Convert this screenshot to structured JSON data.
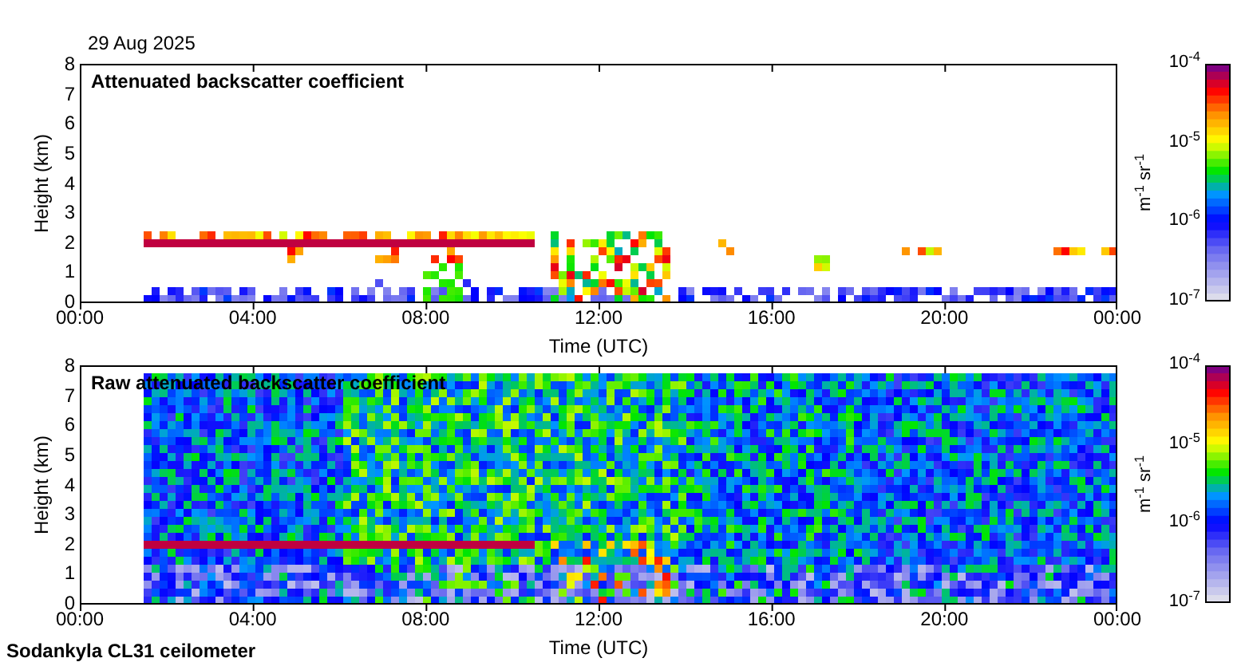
{
  "date": "29 Aug 2025",
  "panels": [
    {
      "kind": "filtered",
      "title": "Attenuated backscatter coefficient",
      "ylabel": "Height (km)",
      "yticks": [
        "8",
        "7",
        "6",
        "5",
        "4",
        "3",
        "2",
        "1",
        "0"
      ],
      "xticks": [
        "00:00",
        "04:00",
        "08:00",
        "12:00",
        "16:00",
        "20:00",
        "00:00"
      ],
      "xlabel": "Time (UTC)",
      "colorbar": {
        "unit": "m$^{-1}$ sr$^{-1}$",
        "ticks": [
          "10$^{-4}$",
          "10$^{-5}$",
          "10$^{-6}$",
          "10$^{-7}$"
        ]
      }
    },
    {
      "kind": "raw",
      "title": "Raw attenuated backscatter coefficient",
      "ylabel": "Height (km)",
      "yticks": [
        "8",
        "7",
        "6",
        "5",
        "4",
        "3",
        "2",
        "1",
        "0"
      ],
      "xticks": [
        "00:00",
        "04:00",
        "08:00",
        "12:00",
        "16:00",
        "20:00",
        "00:00"
      ],
      "xlabel": "Time (UTC)",
      "colorbar": {
        "unit": "m$^{-1}$ sr$^{-1}$",
        "ticks": [
          "10$^{-4}$",
          "10$^{-5}$",
          "10$^{-6}$",
          "10$^{-7}$"
        ]
      }
    }
  ],
  "footer": "Sodankyla CL31 ceilometer"
}
